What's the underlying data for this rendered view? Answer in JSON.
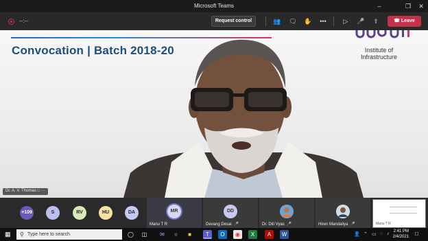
{
  "window": {
    "title": "Microsoft Teams",
    "controls": [
      "minimize-icon",
      "restore-icon",
      "close-icon"
    ]
  },
  "meeting_toolbar": {
    "timer": "--:--",
    "request_control_label": "Request control",
    "leave_label": "Leave",
    "icons": [
      "people-icon",
      "chat-icon",
      "raise-hand-icon",
      "more-icon",
      "camera-off-icon",
      "mic-off-icon",
      "share-icon"
    ]
  },
  "slide": {
    "title": "Convocation | Batch 2018-20",
    "logo_line1": "Institute of",
    "logo_line2": "Infrastructure"
  },
  "presenter": {
    "name": "Dr. A. V. Thomas",
    "more": "···"
  },
  "participants": {
    "overflow_count": "+109",
    "avatars": [
      {
        "initials": "S",
        "color": "#bdbdf0"
      },
      {
        "initials": "RV",
        "color": "#d7e9b7"
      },
      {
        "initials": "HU",
        "color": "#f7dfa5"
      },
      {
        "initials": "DA",
        "color": "#c7c9f0"
      }
    ],
    "tiles": [
      {
        "name": "Manu T R",
        "initials": "MR"
      },
      {
        "name": "Devang Desai",
        "initials": "DD"
      },
      {
        "name": "Dr. Diti Vyas",
        "initials": ""
      },
      {
        "name": "Hiren Mandaliya",
        "initials": ""
      }
    ],
    "share_tile_name": "Manu T R"
  },
  "taskbar": {
    "search_placeholder": "Type here to search",
    "time": "2:41 PM",
    "date": "2/4/2021"
  },
  "colors": {
    "leave": "#c4314b",
    "title": "#1c4f7a",
    "logo": "#5b3f8c"
  }
}
